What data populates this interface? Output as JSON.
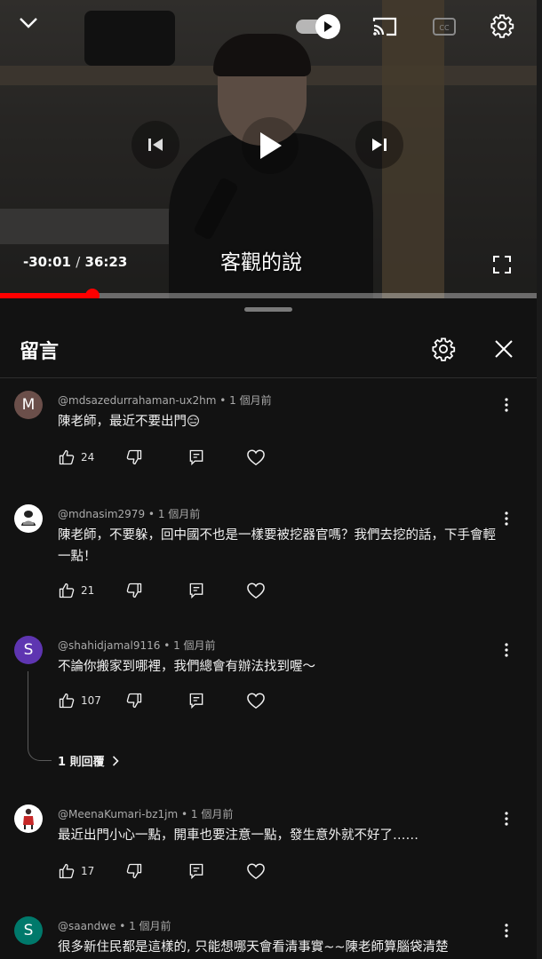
{
  "player": {
    "time_remaining": "-30:01",
    "time_separator": "/",
    "time_total": "36:23",
    "caption": "客觀的說",
    "progress_percent": 17.3,
    "accent_color": "#ff0000",
    "icons": {
      "collapse": "chevron-down-icon",
      "autoplay": "autoplay-toggle-icon",
      "cast": "cast-icon",
      "cc": "closed-captions-icon",
      "settings": "gear-icon",
      "previous": "skip-previous-icon",
      "play": "play-icon",
      "next": "skip-next-icon",
      "fullscreen": "fullscreen-icon"
    }
  },
  "comments_panel": {
    "title": "留言",
    "icons": {
      "settings": "gear-icon",
      "close": "close-icon"
    },
    "comments": [
      {
        "author": "@mdsazedurrahaman-ux2hm",
        "time": "1 個月前",
        "avatar_letter": "M",
        "avatar_color": "#6b4f4a",
        "text": "陳老師，最近不要出門😑",
        "likes": "24"
      },
      {
        "author": "@mdnasim2979",
        "time": "1 個月前",
        "avatar_letter": "",
        "avatar_color": "#ffffff",
        "text": "陳老師，不要躲，回中國不也是一樣要被挖器官嗎？我們去挖的話，下手會輕一點！",
        "likes": "21"
      },
      {
        "author": "@shahidjamal9116",
        "time": "1 個月前",
        "avatar_letter": "S",
        "avatar_color": "#5e35b1",
        "text": "不論你搬家到哪裡，我們總會有辦法找到喔～",
        "likes": "107",
        "replies_label": "1 則回覆"
      },
      {
        "author": "@MeenaKumari-bz1jm",
        "time": "1 個月前",
        "avatar_letter": "",
        "avatar_color": "#ffffff",
        "text": "最近出門小心一點，開車也要注意一點，發生意外就不好了……",
        "likes": "17"
      },
      {
        "author": "@saandwe",
        "time": "1 個月前",
        "avatar_letter": "S",
        "avatar_color": "#00796b",
        "text": "很多新住民都是這樣的, 只能想哪天會看清事實~~陳老師算腦袋清楚"
      }
    ]
  }
}
